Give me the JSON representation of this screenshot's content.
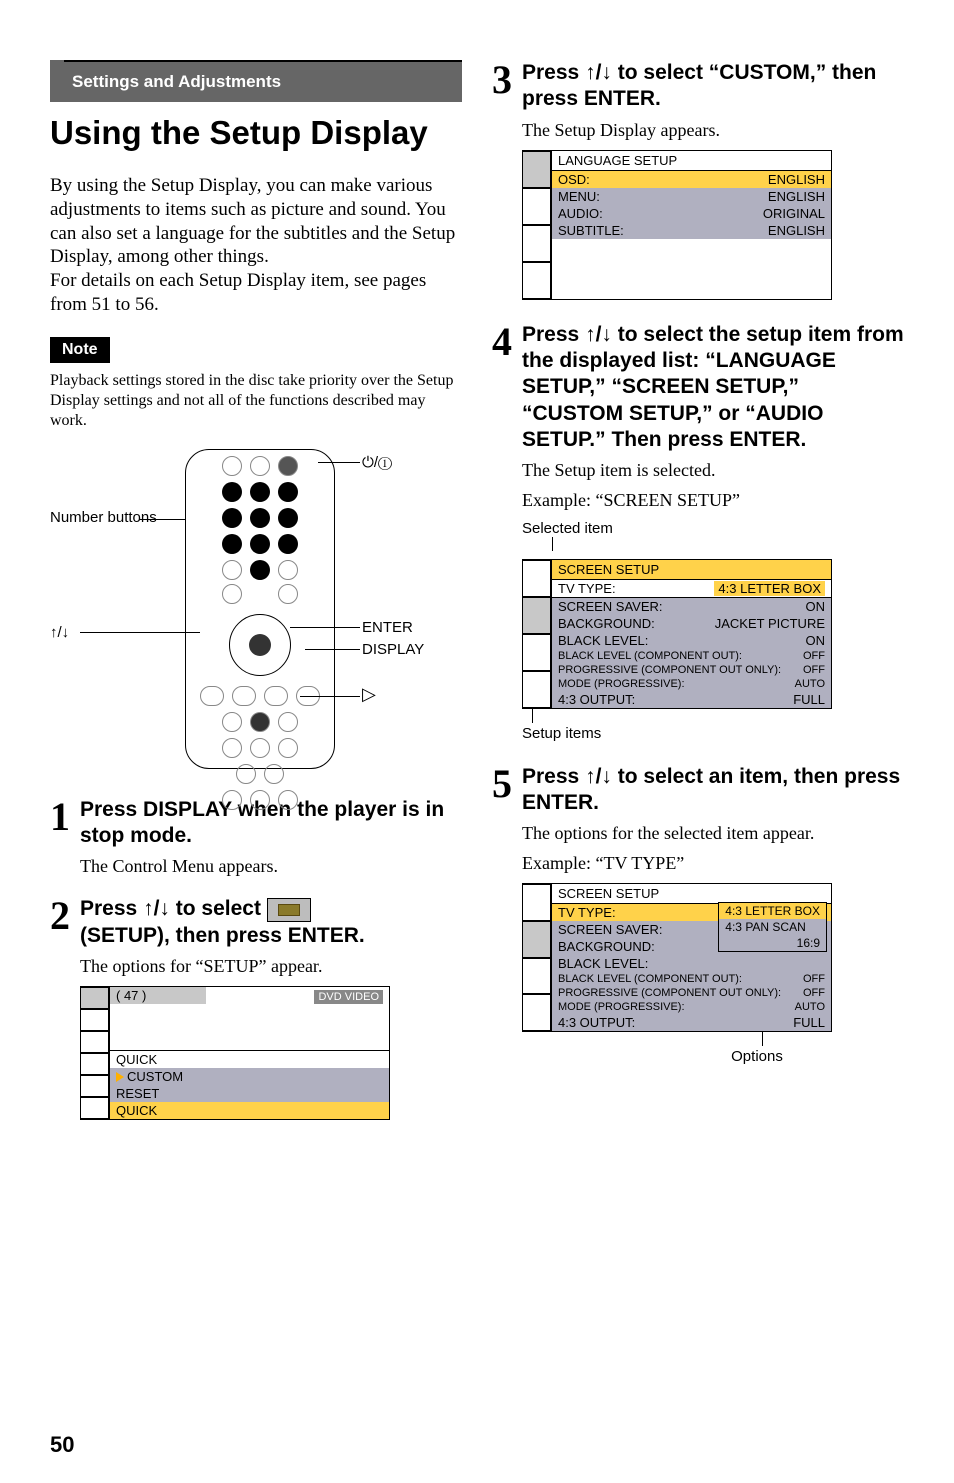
{
  "section_bar": "Settings and Adjustments",
  "title": "Using the Setup Display",
  "intro": "By using the Setup Display, you can make various adjustments to items such as picture and sound. You can also set a language for the subtitles and the Setup Display, among other things.\nFor details on each Setup Display item, see pages from 51 to 56.",
  "note_label": "Note",
  "note_body": "Playback settings stored in the disc take priority over the Setup Display settings and not all of the functions described may work.",
  "remote_labels": {
    "number_buttons": "Number buttons",
    "updown": "↑/↓",
    "power": "&/1",
    "enter": "ENTER",
    "display": "DISPLAY",
    "play": "▷"
  },
  "step1": {
    "num": "1",
    "head": "Press DISPLAY when the player is in stop mode.",
    "sub": "The Control Menu appears."
  },
  "step2": {
    "num": "2",
    "head_pre": "Press ",
    "head_arrows": "↑/↓",
    "head_mid": " to select ",
    "head_post": " (SETUP), then press ENTER.",
    "sub": "The options for “SETUP” appear.",
    "osd": {
      "counter": "( 47 )",
      "badge": "DVD VIDEO",
      "menu": [
        "QUICK",
        "CUSTOM",
        "RESET",
        "QUICK"
      ]
    }
  },
  "step3": {
    "num": "3",
    "head_pre": "Press ",
    "head_arrows": "↑/↓",
    "head_post": " to select “CUSTOM,” then press ENTER.",
    "sub": "The Setup Display appears.",
    "osd": {
      "title": "LANGUAGE SETUP",
      "rows": [
        {
          "k": "OSD:",
          "v": "ENGLISH"
        },
        {
          "k": "MENU:",
          "v": "ENGLISH"
        },
        {
          "k": "AUDIO:",
          "v": "ORIGINAL"
        },
        {
          "k": "SUBTITLE:",
          "v": "ENGLISH"
        }
      ]
    }
  },
  "step4": {
    "num": "4",
    "head_pre": "Press ",
    "head_arrows": "↑/↓",
    "head_post": " to select the setup item from the displayed list: “LANGUAGE SETUP,” “SCREEN SETUP,” “CUSTOM SETUP,” or “AUDIO SETUP.” Then press ENTER.",
    "sub1": "The Setup item is selected.",
    "sub2": "Example: “SCREEN SETUP”",
    "selected_label": "Selected item",
    "setupitems_label": "Setup items",
    "osd": {
      "title": "SCREEN SETUP",
      "rows": [
        {
          "k": "TV TYPE:",
          "v": "4:3 LETTER BOX",
          "hl": true
        },
        {
          "k": "SCREEN SAVER:",
          "v": "ON"
        },
        {
          "k": "BACKGROUND:",
          "v": "JACKET PICTURE"
        },
        {
          "k": "BLACK LEVEL:",
          "v": "ON"
        },
        {
          "k": "BLACK LEVEL (COMPONENT OUT):",
          "v": "OFF",
          "small": true
        },
        {
          "k": "PROGRESSIVE (COMPONENT OUT ONLY):",
          "v": "OFF",
          "small": true
        },
        {
          "k": "MODE (PROGRESSIVE):",
          "v": "AUTO",
          "small": true
        },
        {
          "k": "4:3 OUTPUT:",
          "v": "FULL"
        }
      ]
    }
  },
  "step5": {
    "num": "5",
    "head_pre": "Press ",
    "head_arrows": "↑/↓",
    "head_post": " to select an item, then press ENTER.",
    "sub1": "The options for the selected item appear.",
    "sub2": "Example: “TV TYPE”",
    "options_label": "Options",
    "osd": {
      "title": "SCREEN SETUP",
      "rows": [
        {
          "k": "TV TYPE:",
          "v": "4:3 LETTER BOX"
        },
        {
          "k": "SCREEN SAVER:",
          "v": ""
        },
        {
          "k": "BACKGROUND:",
          "v": ""
        },
        {
          "k": "BLACK LEVEL:",
          "v": ""
        },
        {
          "k": "BLACK LEVEL (COMPONENT OUT):",
          "v": "OFF",
          "small": true
        },
        {
          "k": "PROGRESSIVE (COMPONENT OUT ONLY):",
          "v": "OFF",
          "small": true
        },
        {
          "k": "MODE (PROGRESSIVE):",
          "v": "AUTO",
          "small": true
        },
        {
          "k": "4:3 OUTPUT:",
          "v": "FULL"
        }
      ],
      "options": [
        "4:3 LETTER BOX",
        "4:3 PAN SCAN",
        "16:9"
      ]
    }
  },
  "page_number": "50"
}
